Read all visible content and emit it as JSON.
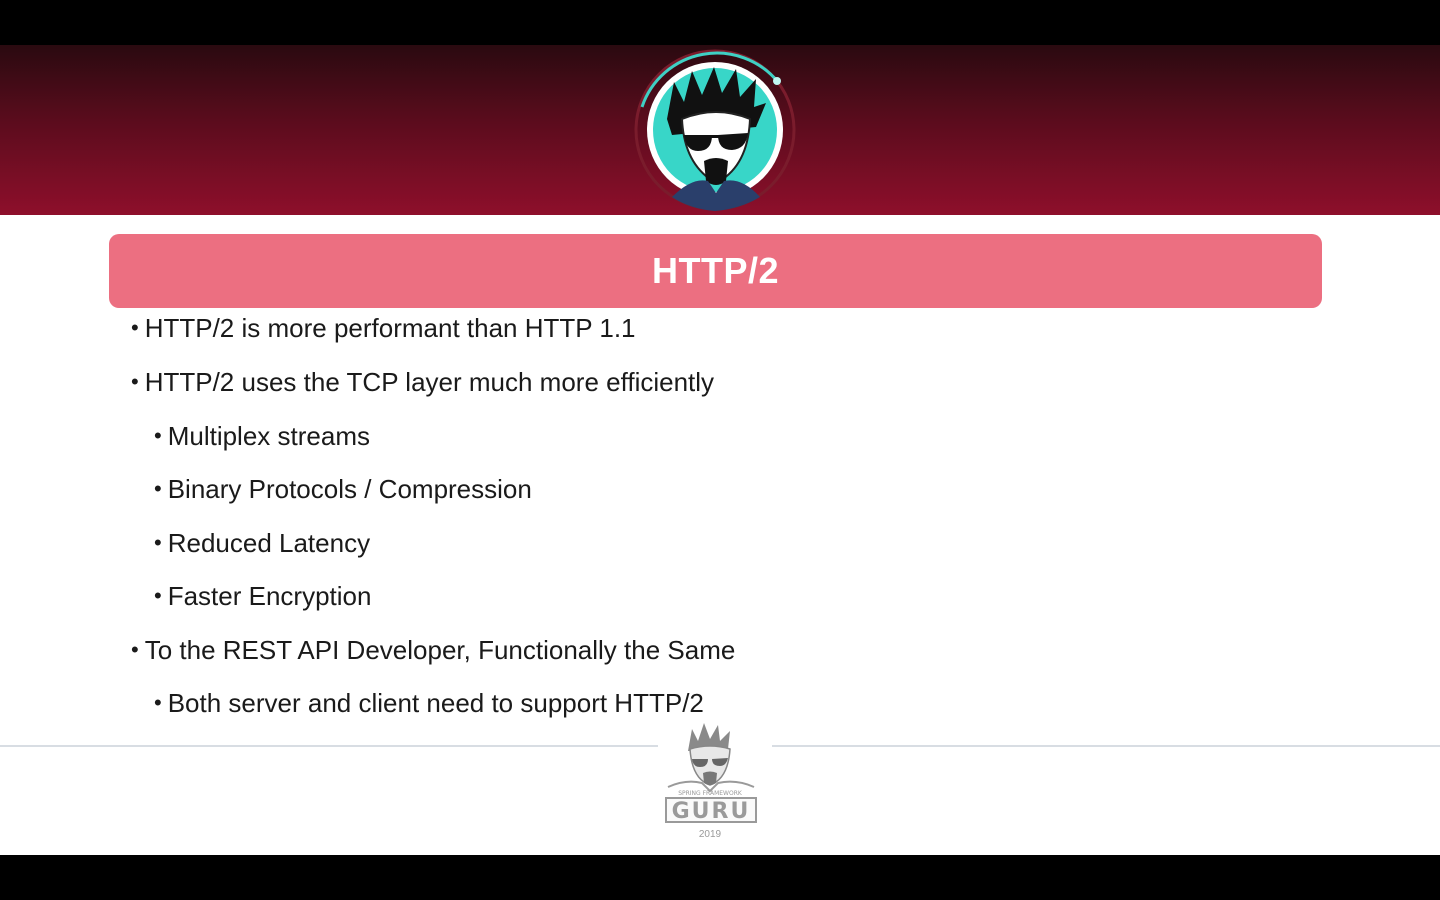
{
  "slide": {
    "title": "HTTP/2",
    "bullets": [
      {
        "level": 1,
        "text": "HTTP/2 is more performant than HTTP 1.1"
      },
      {
        "level": 1,
        "text": "HTTP/2 uses the TCP layer much more efficiently"
      },
      {
        "level": 2,
        "text": "Multiplex streams"
      },
      {
        "level": 2,
        "text": "Binary Protocols / Compression"
      },
      {
        "level": 2,
        "text": "Reduced Latency"
      },
      {
        "level": 2,
        "text": "Faster Encryption"
      },
      {
        "level": 1,
        "text": "To the REST API Developer, Functionally the Same"
      },
      {
        "level": 2,
        "text": "Both server and client need to support HTTP/2"
      }
    ],
    "bullet_glyph": "•"
  },
  "logo": {
    "tagline": "SPRING FRAMEWORK",
    "wordmark": "GURU",
    "year": "2019"
  },
  "colors": {
    "banner_top": "#2a0a10",
    "banner_bottom": "#8e0f2b",
    "title_bar": "#ec6f81",
    "avatar_bg": "#36d6c8"
  },
  "icons": {
    "avatar": "guru-mascot-avatar",
    "footer_logo": "spring-framework-guru-logo"
  }
}
